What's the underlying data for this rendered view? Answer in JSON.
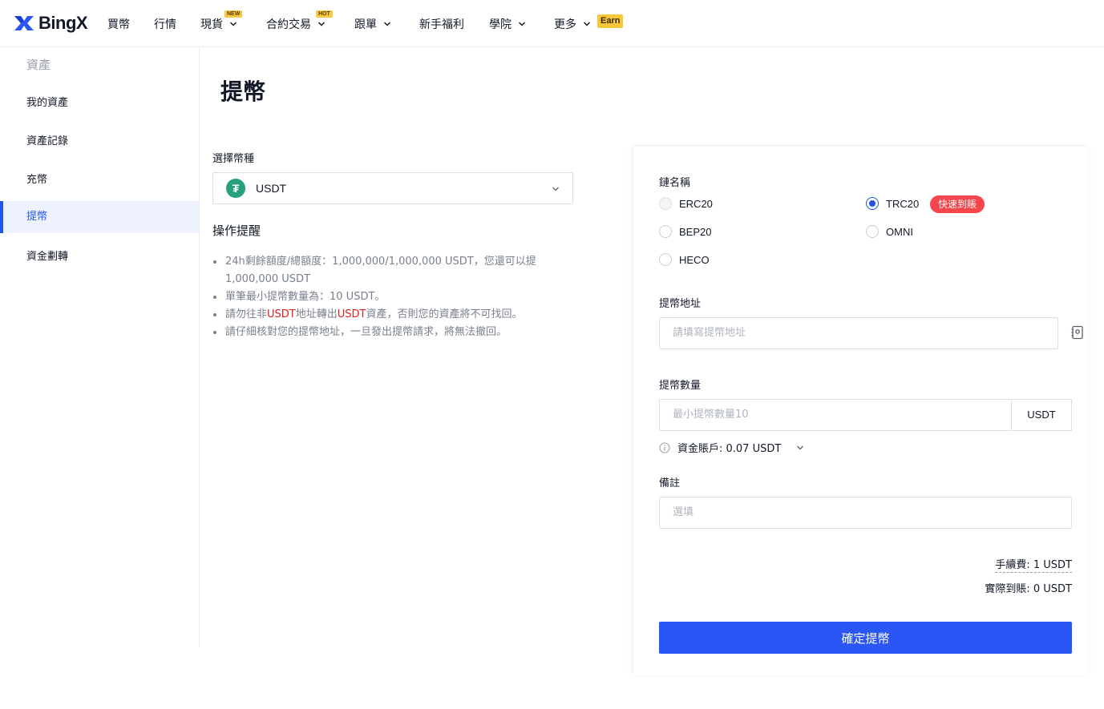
{
  "header": {
    "logo_text": "BingX",
    "nav": [
      {
        "label": "買幣"
      },
      {
        "label": "行情"
      },
      {
        "label": "現貨",
        "badge": "NEW"
      },
      {
        "label": "合約交易",
        "badge": "HOT"
      },
      {
        "label": "跟單"
      },
      {
        "label": "新手福利"
      },
      {
        "label": "學院"
      },
      {
        "label": "更多",
        "badge": "Earn"
      }
    ]
  },
  "sidebar": {
    "title": "資產",
    "items": [
      {
        "label": "我的資產"
      },
      {
        "label": "資產記錄"
      },
      {
        "label": "充幣"
      },
      {
        "label": "提幣",
        "active": true
      },
      {
        "label": "資金劃轉"
      }
    ]
  },
  "main": {
    "title": "提幣",
    "coin_select": {
      "label": "選擇幣種",
      "value": "USDT",
      "icon": "tether-icon"
    },
    "notes": {
      "title": "操作提醒",
      "items": [
        "24h剩餘額度/總額度：1,000,000/1,000,000 USDT，您還可以提1,000,000 USDT",
        "單筆最小提幣數量為：10 USDT。",
        {
          "pre": "請勿往非",
          "red1": "USDT",
          "mid": "地址轉出",
          "red2": "USDT",
          "post": "資產，否則您的資產將不可找回。"
        },
        "請仔細核對您的提幣地址，一旦發出提幣請求，將無法撤回。"
      ]
    }
  },
  "form": {
    "chain": {
      "label": "鏈名稱",
      "options": [
        "ERC20",
        "TRC20",
        "BEP20",
        "OMNI",
        "HECO"
      ],
      "selected": "TRC20",
      "fast_badge": "快速到賬"
    },
    "address": {
      "label": "提幣地址",
      "placeholder": "請填寫提幣地址"
    },
    "amount": {
      "label": "提幣數量",
      "placeholder": "最小提幣數量10",
      "unit": "USDT",
      "balance": "資金賬戶: 0.07 USDT"
    },
    "memo": {
      "label": "備註",
      "placeholder": "選填"
    },
    "fee": "手續費:  1 USDT",
    "received": "實際到賬:  0 USDT",
    "submit_label": "確定提幣"
  },
  "colors": {
    "accent": "#2a56f5",
    "sidebar_active": "#2354e6",
    "badge_red": "#f5454c",
    "tether": "#26a17b"
  }
}
